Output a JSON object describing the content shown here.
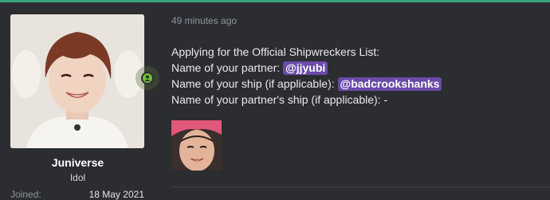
{
  "post": {
    "timestamp": "49 minutes ago",
    "lines": {
      "l1": "Applying for the Official Shipwreckers List:",
      "l2_label": "Name of your partner: ",
      "l2_mention": "@jjyubi",
      "l3_label": "Name of your ship (if applicable): ",
      "l3_mention": "@badcrookshanks",
      "l4": "Name of your partner's ship (if applicable): -"
    }
  },
  "user": {
    "name": "Juniverse",
    "title": "Idol",
    "joined_label": "Joined:",
    "joined_date": "18 May 2021",
    "status": "online"
  },
  "colors": {
    "background": "#2b2d31",
    "mention_bg": "#6a4aa8",
    "accent_rule": "#3aa57f",
    "online": "#6fbf3a"
  },
  "icons": {
    "online_indicator": "user-online-icon"
  }
}
